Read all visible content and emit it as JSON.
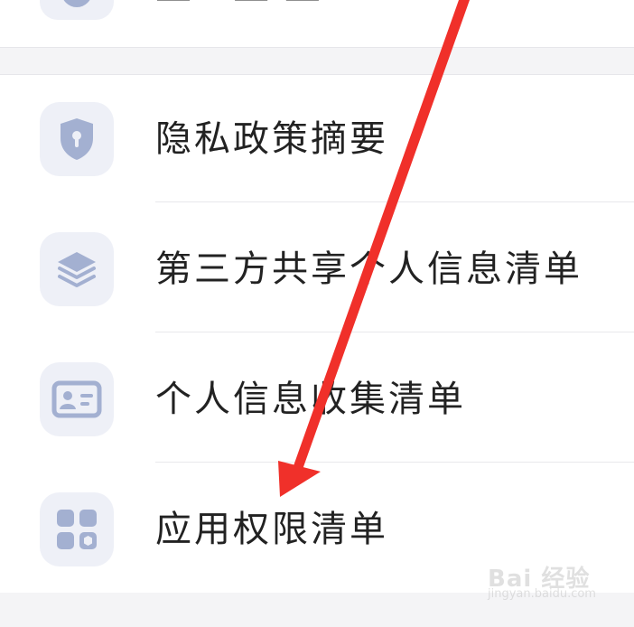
{
  "top_section": {
    "partial_label": "— · — — ·"
  },
  "menu": {
    "items": [
      {
        "label": "隐私政策摘要",
        "icon": "shield-keyhole-icon"
      },
      {
        "label": "第三方共享个人信息清单",
        "icon": "layers-icon"
      },
      {
        "label": "个人信息收集清单",
        "icon": "id-card-icon"
      },
      {
        "label": "应用权限清单",
        "icon": "apps-grid-icon"
      }
    ]
  },
  "watermark": {
    "brand": "Bai 经验",
    "url": "jingyan.baidu.com"
  },
  "colors": {
    "icon_bg": "#eef0f7",
    "icon_fg": "#a3b0d1",
    "arrow": "#f0302a",
    "text": "#222222"
  }
}
